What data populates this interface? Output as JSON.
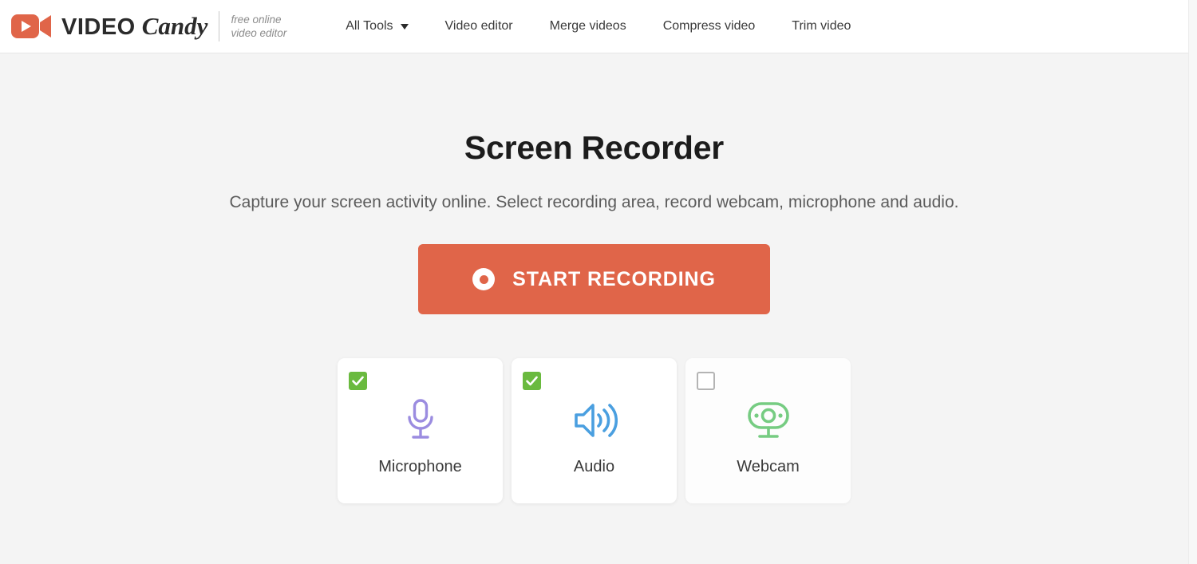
{
  "header": {
    "logo": {
      "icon": "video-camera-icon",
      "brand_primary": "VIDEO",
      "brand_secondary": "Candy",
      "tagline_line1": "free online",
      "tagline_line2": "video editor",
      "brand_color": "#e06549"
    },
    "nav": [
      {
        "label": "All Tools",
        "has_dropdown": true,
        "icon": "chevron-down-icon"
      },
      {
        "label": "Video editor",
        "has_dropdown": false
      },
      {
        "label": "Merge videos",
        "has_dropdown": false
      },
      {
        "label": "Compress video",
        "has_dropdown": false
      },
      {
        "label": "Trim video",
        "has_dropdown": false
      }
    ]
  },
  "main": {
    "title": "Screen Recorder",
    "subtitle": "Capture your screen activity online. Select recording area, record webcam, microphone and audio.",
    "start_button": {
      "label": "START RECORDING",
      "icon": "record-circle-icon",
      "color": "#e06549"
    },
    "options": [
      {
        "label": "Microphone",
        "icon": "microphone-icon",
        "icon_color": "#9b8ce0",
        "checked": true
      },
      {
        "label": "Audio",
        "icon": "speaker-volume-icon",
        "icon_color": "#4a9fe0",
        "checked": true
      },
      {
        "label": "Webcam",
        "icon": "webcam-icon",
        "icon_color": "#76cc82",
        "checked": false
      }
    ],
    "checkbox_checked_color": "#6aba3f",
    "background_color": "#f4f4f4"
  }
}
